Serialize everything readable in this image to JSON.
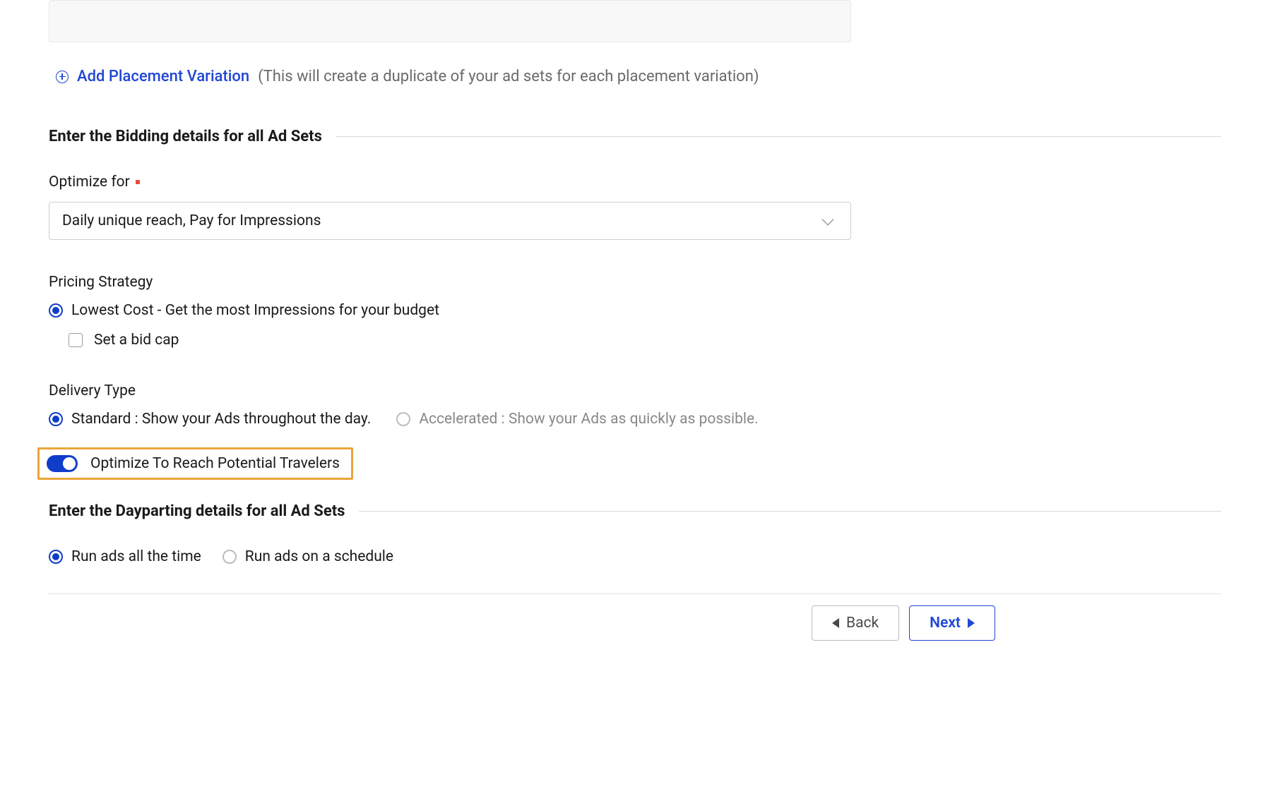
{
  "placement": {
    "add_link_label": "Add Placement Variation",
    "add_hint": "(This will create a duplicate of your ad sets for each placement variation)"
  },
  "bidding": {
    "section_title": "Enter the Bidding details for all Ad Sets",
    "optimize_label": "Optimize for",
    "optimize_selected": "Daily unique reach, Pay for Impressions",
    "pricing_strategy_label": "Pricing Strategy",
    "pricing_option_lowest": "Lowest Cost - Get the most Impressions for your budget",
    "bid_cap_label": "Set a bid cap",
    "delivery_type_label": "Delivery Type",
    "delivery_standard": "Standard : Show your Ads throughout the day.",
    "delivery_accelerated": "Accelerated : Show your Ads as quickly as possible.",
    "optimize_travelers_label": "Optimize To Reach Potential Travelers"
  },
  "dayparting": {
    "section_title": "Enter the Dayparting details for all Ad Sets",
    "option_all_time": "Run ads all the time",
    "option_schedule": "Run ads on a schedule"
  },
  "footer": {
    "back_label": "Back",
    "next_label": "Next"
  }
}
